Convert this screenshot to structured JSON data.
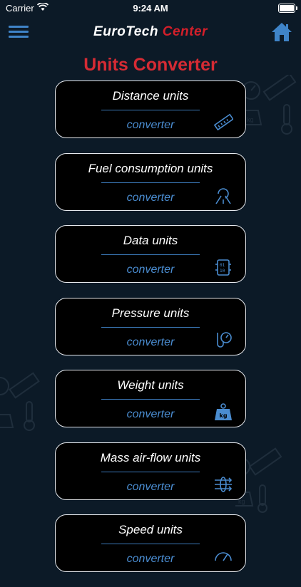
{
  "status": {
    "carrier": "Carrier",
    "time": "9:24 AM"
  },
  "header": {
    "logo_part1": "EuroTech",
    "logo_part2": "Center",
    "menu_icon": "hamburger-menu-icon",
    "home_icon": "home-icon"
  },
  "page_title": "Units Converter",
  "colors": {
    "accent": "#3f84c8",
    "brand_red": "#d52b34",
    "background": "#0c1a27"
  },
  "cards": [
    {
      "title": "Distance units",
      "subtitle": "converter",
      "icon": "ruler-icon"
    },
    {
      "title": "Fuel consumption units",
      "subtitle": "converter",
      "icon": "fuel-road-icon"
    },
    {
      "title": "Data units",
      "subtitle": "converter",
      "icon": "data-chip-icon"
    },
    {
      "title": "Pressure units",
      "subtitle": "converter",
      "icon": "pressure-gauge-icon"
    },
    {
      "title": "Weight units",
      "subtitle": "converter",
      "icon": "weight-kg-icon"
    },
    {
      "title": "Mass air-flow units",
      "subtitle": "converter",
      "icon": "air-flow-icon"
    },
    {
      "title": "Speed units",
      "subtitle": "converter",
      "icon": "speedometer-icon"
    }
  ]
}
